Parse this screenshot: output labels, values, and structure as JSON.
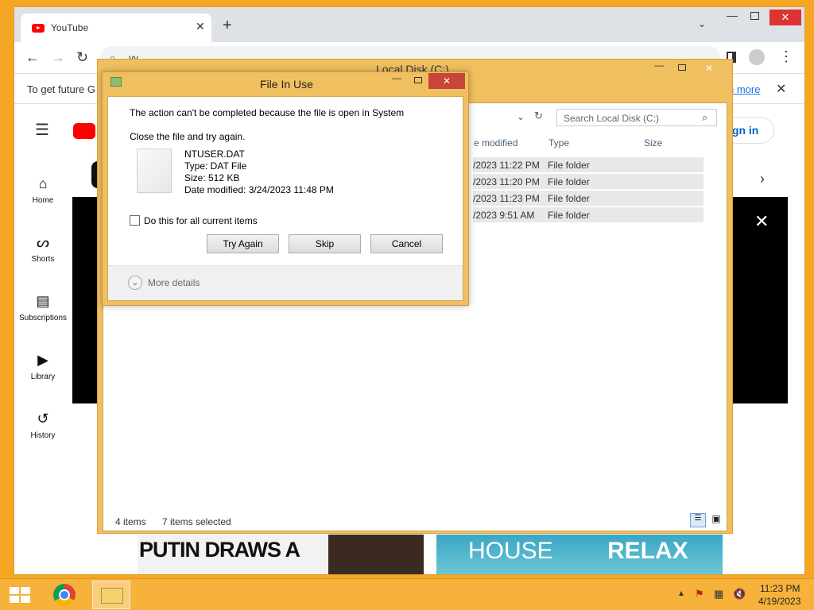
{
  "chrome": {
    "tab_title": "YouTube",
    "omnibox_text": "yy",
    "infobar_text": "To get future G",
    "infobar_link": "n more",
    "colors": {
      "youtube_red": "#ff0000",
      "tabstrip": "#dee1e6"
    }
  },
  "youtube": {
    "sign_in": "ign in",
    "sidebar": [
      {
        "label": "Home",
        "icon": "home-icon"
      },
      {
        "label": "Shorts",
        "icon": "shorts-icon"
      },
      {
        "label": "Subscriptions",
        "icon": "subscriptions-icon"
      },
      {
        "label": "Library",
        "icon": "library-icon"
      },
      {
        "label": "History",
        "icon": "history-icon"
      }
    ],
    "thumb1_text": "PUTIN DRAWS A",
    "thumb2_text_a": "HOUSE",
    "thumb2_text_b": "RELAX"
  },
  "explorer": {
    "title": "Local Disk (C:)",
    "search_placeholder": "Search Local Disk (C:)",
    "columns": {
      "modified": "e modified",
      "type": "Type",
      "size": "Size"
    },
    "rows": [
      {
        "modified": "/2023 11:22 PM",
        "type": "File folder"
      },
      {
        "modified": "/2023 11:20 PM",
        "type": "File folder"
      },
      {
        "modified": "/2023 11:23 PM",
        "type": "File folder"
      },
      {
        "modified": "/2023 9:51 AM",
        "type": "File folder"
      }
    ],
    "status_items": "4 items",
    "status_selected": "7 items selected"
  },
  "dialog": {
    "title": "File In Use",
    "message": "The action can't be completed because the file is open in System",
    "instruction": "Close the file and try again.",
    "file_name": "NTUSER.DAT",
    "file_type": "Type: DAT File",
    "file_size": "Size: 512 KB",
    "file_modified": "Date modified: 3/24/2023 11:48 PM",
    "checkbox_label": "Do this for all current items",
    "btn_try_again": "Try Again",
    "btn_skip": "Skip",
    "btn_cancel": "Cancel",
    "more_details": "More details"
  },
  "taskbar": {
    "time": "11:23 PM",
    "date": "4/19/2023"
  }
}
